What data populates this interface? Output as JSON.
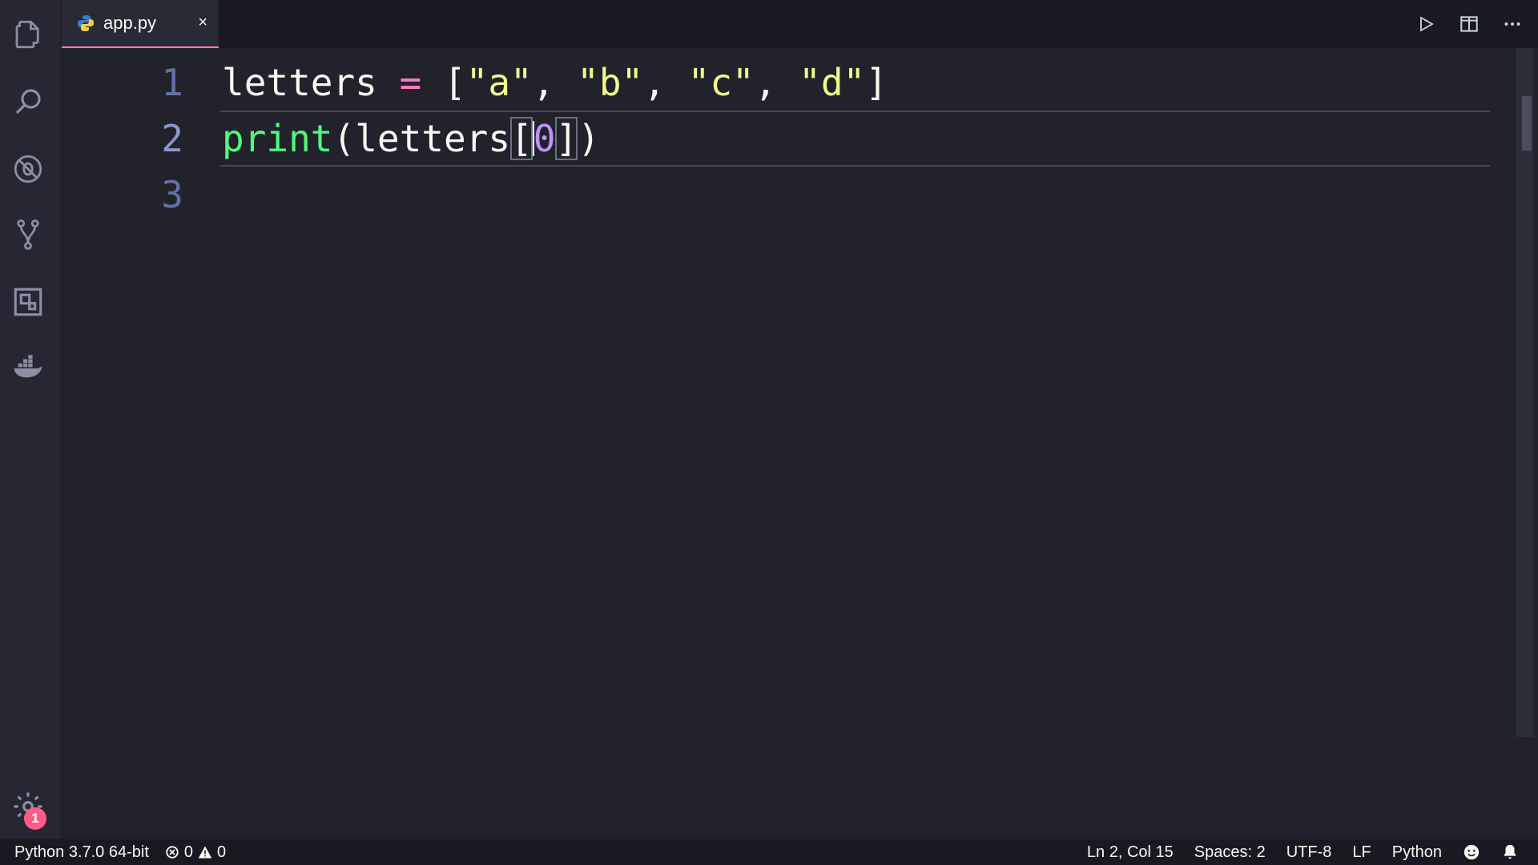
{
  "window": {
    "active_tab": {
      "filename": "app.py",
      "icon": "python-icon",
      "close_glyph": "×"
    }
  },
  "activity_bar": {
    "items": [
      {
        "name": "explorer",
        "icon": "files-icon"
      },
      {
        "name": "search",
        "icon": "search-icon"
      },
      {
        "name": "debug",
        "icon": "debug-icon"
      },
      {
        "name": "source-control",
        "icon": "git-branch-icon"
      },
      {
        "name": "extensions",
        "icon": "extensions-icon"
      },
      {
        "name": "docker",
        "icon": "docker-icon"
      }
    ],
    "settings": {
      "icon": "gear-icon",
      "badge": "1"
    }
  },
  "editor": {
    "lines": [
      {
        "number": "1",
        "tokens": [
          {
            "t": "letters",
            "k": "ident"
          },
          {
            "t": " ",
            "k": "punc"
          },
          {
            "t": "=",
            "k": "op"
          },
          {
            "t": " [",
            "k": "punc"
          },
          {
            "t": "\"a\"",
            "k": "str"
          },
          {
            "t": ", ",
            "k": "punc"
          },
          {
            "t": "\"b\"",
            "k": "str"
          },
          {
            "t": ", ",
            "k": "punc"
          },
          {
            "t": "\"c\"",
            "k": "str"
          },
          {
            "t": ", ",
            "k": "punc"
          },
          {
            "t": "\"d\"",
            "k": "str"
          },
          {
            "t": "]",
            "k": "punc"
          }
        ]
      },
      {
        "number": "2",
        "current": true,
        "tokens": [
          {
            "t": "print",
            "k": "func"
          },
          {
            "t": "(",
            "k": "punc"
          },
          {
            "t": "letters",
            "k": "ident"
          },
          {
            "t": "[",
            "k": "punc",
            "hl": true
          },
          {
            "t": "|",
            "k": "cursor"
          },
          {
            "t": "0",
            "k": "num"
          },
          {
            "t": "]",
            "k": "punc",
            "hl": true
          },
          {
            "t": ")",
            "k": "punc"
          }
        ]
      },
      {
        "number": "3",
        "tokens": []
      }
    ]
  },
  "status_bar": {
    "interpreter": "Python 3.7.0 64-bit",
    "errors": "0",
    "warnings": "0",
    "cursor_position": "Ln 2, Col 15",
    "indentation": "Spaces: 2",
    "encoding": "UTF-8",
    "line_ending": "LF",
    "language": "Python"
  },
  "colors": {
    "background": "#21222c",
    "accent_pink": "#ff79c6",
    "string_yellow": "#f1fa8c",
    "function_green": "#50fa7b",
    "number_purple": "#bd93f9",
    "line_number": "#6272a4"
  }
}
